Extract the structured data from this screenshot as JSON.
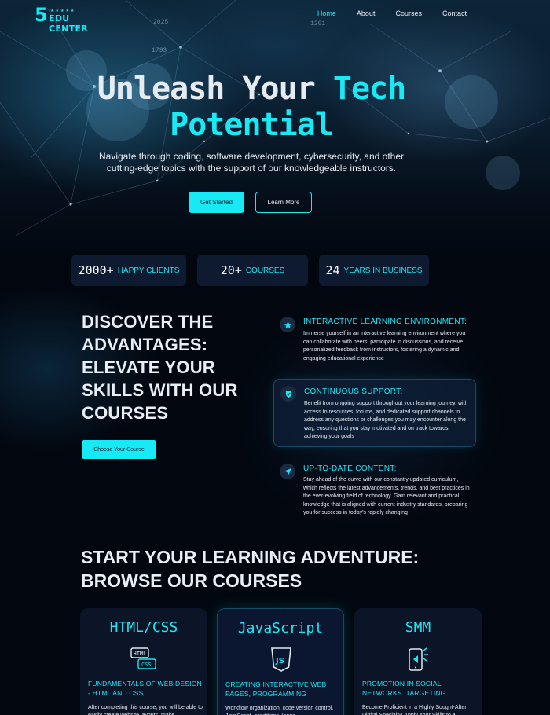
{
  "logo": {
    "number": "5",
    "stars": "★★★★★",
    "text": "EDU CENTER"
  },
  "nav": {
    "items": [
      "Home",
      "About",
      "Courses",
      "Contact"
    ],
    "active": "Home"
  },
  "hero": {
    "title_part1": "Unleash Your ",
    "title_accent1": "Tech",
    "title_accent2": "Potential",
    "subtitle": "Navigate through coding, software development, cybersecurity, and other cutting-edge topics with the support of our knowledgeable instructors.",
    "primary_button": "Get Started",
    "secondary_button": "Learn More",
    "background_numbers": [
      "2025",
      "1201",
      "1793"
    ]
  },
  "stats": [
    {
      "number": "2000+",
      "label": "HAPPY CLIENTS"
    },
    {
      "number": "20+",
      "label": "COURSES"
    },
    {
      "number": "24",
      "label": "YEARS IN BUSINESS"
    }
  ],
  "advantages": {
    "title": "DISCOVER THE ADVANTAGES: ELEVATE YOUR SKILLS WITH OUR COURSES",
    "button": "Choose Your Course",
    "features": [
      {
        "icon": "star-icon",
        "title": "INTERACTIVE LEARNING ENVIRONMENT:",
        "description": "Immerse yourself in an interactive learning environment where you can collaborate with peers, participate in discussions, and receive personalized feedback from instructors, fostering a dynamic and engaging educational experience"
      },
      {
        "icon": "shield-icon",
        "title": "CONTINUOUS SUPPORT:",
        "description": "Benefit from ongoing support throughout your learning journey, with access to resources, forums, and dedicated support channels to address any questions or challenges you may encounter along the way, ensuring that you stay motivated and on track towards achieving your goals"
      },
      {
        "icon": "send-icon",
        "title": "UP-TO-DATE CONTENT:",
        "description": "Stay ahead of the curve with our constantly updated curriculum, which reflects the latest advancements, trends, and best practices in the ever-evolving field of technology. Gain relevant and practical knowledge that is aligned with current industry standards, preparing you for success in today's rapidly changing"
      }
    ]
  },
  "courses": {
    "title": "START YOUR LEARNING ADVENTURE: BROWSE OUR COURSES",
    "cards": [
      {
        "name": "HTML/CSS",
        "icon": "html-css-icon",
        "icon_text_top": "HTML",
        "icon_text_bottom": "CSS",
        "subtitle": "FUNDAMENTALS OF WEB DESIGN - HTML AND CSS",
        "description": "After completing this course, you will be able to easily create website layouts, make"
      },
      {
        "name": "JavaScript",
        "icon": "js-shield-icon",
        "icon_text_top": "JS",
        "subtitle": "CREATING INTERACTIVE WEB PAGES, PROGRAMMING",
        "description": "Workflow organization, code version control, JavaScript, conditions, loops"
      },
      {
        "name": "SMM",
        "icon": "smm-phone-icon",
        "subtitle": "PROMOTION IN SOCIAL NETWORKS. TARGETING",
        "description": "Become Proficient in a Highly Sought-After Digital Specialty!  Apply Your Skills to a"
      }
    ]
  },
  "colors": {
    "accent": "#17e9f5",
    "background": "#02070f",
    "card": "#0c1428",
    "text": "#e6ebf2"
  }
}
